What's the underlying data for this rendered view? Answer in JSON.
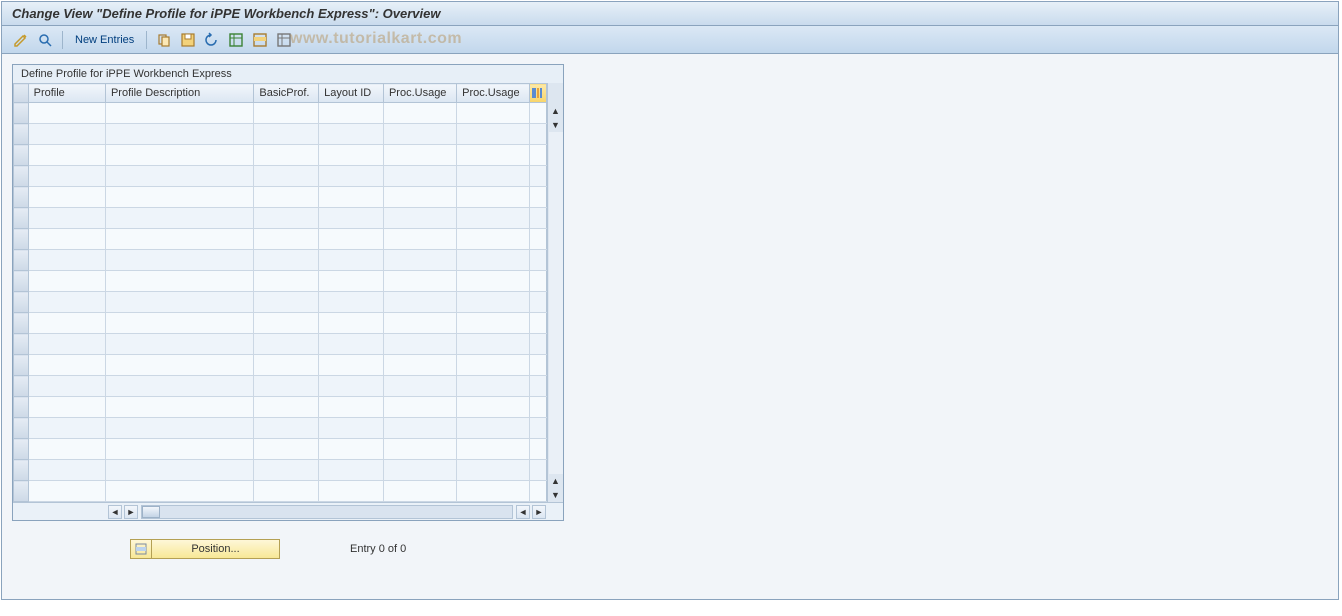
{
  "title": "Change View \"Define Profile for iPPE Workbench Express\": Overview",
  "watermark": "www.tutorialkart.com",
  "toolbar": {
    "new_entries": "New Entries"
  },
  "panel": {
    "title": "Define Profile for iPPE Workbench Express",
    "columns": {
      "profile": "Profile",
      "description": "Profile Description",
      "basic_prof": "BasicProf.",
      "layout_id": "Layout ID",
      "proc_usage1": "Proc.Usage",
      "proc_usage2": "Proc.Usage"
    },
    "row_count": 19
  },
  "footer": {
    "position_label": "Position...",
    "entry_text": "Entry 0 of 0"
  }
}
